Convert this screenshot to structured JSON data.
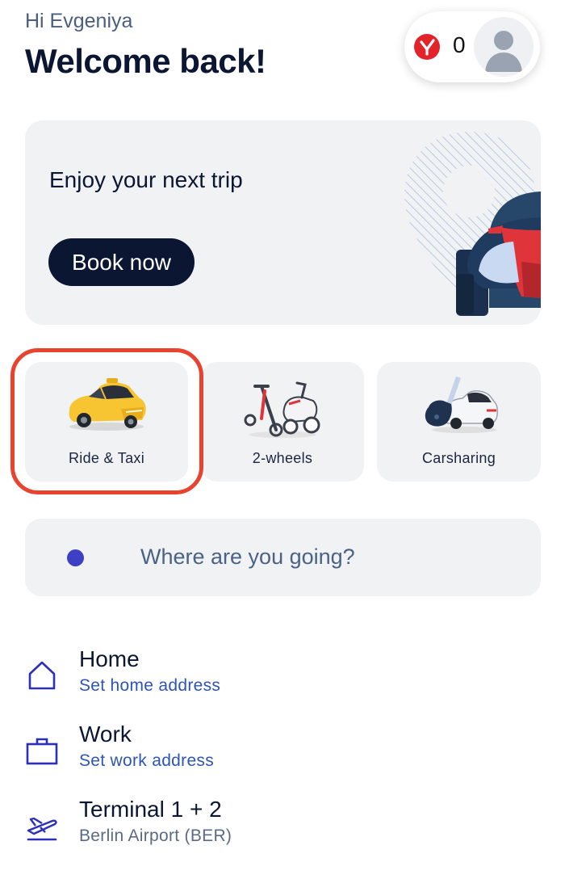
{
  "header": {
    "greeting": "Hi Evgeniya",
    "welcome": "Welcome back!",
    "points_value": "0",
    "points_icon": "rewards-badge-icon",
    "avatar_icon": "user-avatar-icon"
  },
  "promo": {
    "text": "Enjoy your next trip",
    "button_label": "Book now",
    "illustration": "car-with-map-pin-illustration"
  },
  "services": [
    {
      "label": "Ride & Taxi",
      "icon": "taxi-car-icon",
      "highlighted": true
    },
    {
      "label": "2-wheels",
      "icon": "scooter-icon",
      "highlighted": false
    },
    {
      "label": "Carsharing",
      "icon": "car-key-icon",
      "highlighted": false
    }
  ],
  "search": {
    "placeholder": "Where are you going?"
  },
  "places": [
    {
      "title": "Home",
      "subtitle": "Set home address",
      "icon": "home-icon"
    },
    {
      "title": "Work",
      "subtitle": "Set work address",
      "icon": "briefcase-icon"
    },
    {
      "title": "Terminal 1 + 2",
      "subtitle": "Berlin Airport (BER)",
      "icon": "airplane-icon"
    }
  ],
  "colors": {
    "primary_dark": "#0b1633",
    "accent_blue": "#3d3fc4",
    "link_blue": "#2d54b8",
    "highlight_red": "#e7432e",
    "card_gray": "#f1f2f4"
  }
}
